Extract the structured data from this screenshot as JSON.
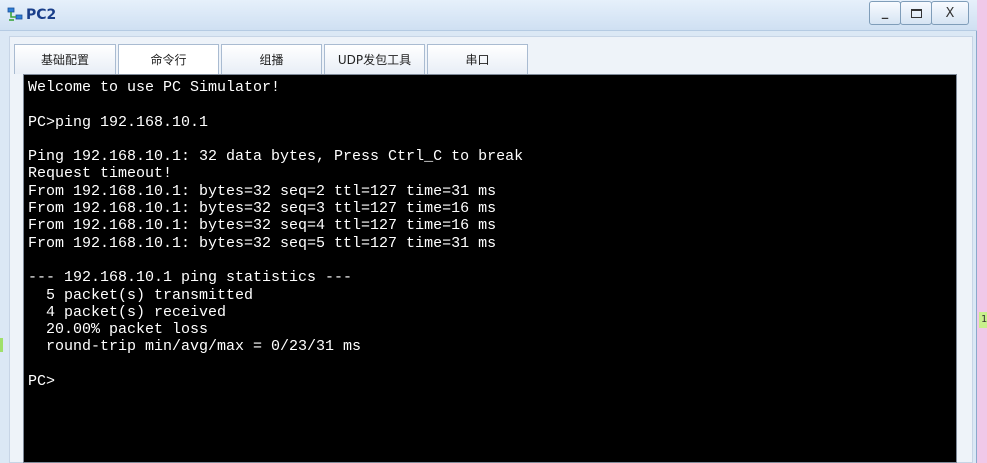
{
  "window": {
    "title": "PC2",
    "minimize_label": "_",
    "close_label": "X"
  },
  "tabs": [
    {
      "label": "基础配置"
    },
    {
      "label": "命令行"
    },
    {
      "label": "组播"
    },
    {
      "label": "UDP发包工具"
    },
    {
      "label": "串口"
    }
  ],
  "active_tab": "命令行",
  "terminal": {
    "lines": [
      "Welcome to use PC Simulator!",
      "",
      "PC>ping 192.168.10.1",
      "",
      "Ping 192.168.10.1: 32 data bytes, Press Ctrl_C to break",
      "Request timeout!",
      "From 192.168.10.1: bytes=32 seq=2 ttl=127 time=31 ms",
      "From 192.168.10.1: bytes=32 seq=3 ttl=127 time=16 ms",
      "From 192.168.10.1: bytes=32 seq=4 ttl=127 time=16 ms",
      "From 192.168.10.1: bytes=32 seq=5 ttl=127 time=31 ms",
      "",
      "--- 192.168.10.1 ping statistics ---",
      "  5 packet(s) transmitted",
      "  4 packet(s) received",
      "  20.00% packet loss",
      "  round-trip min/avg/max = 0/23/31 ms",
      "",
      "PC>"
    ]
  },
  "edge_label": "1",
  "colors": {
    "terminal_bg": "#000000",
    "terminal_fg": "#ffffff",
    "title_color": "#1a3f8a",
    "window_bg": "#dbe8f5"
  }
}
